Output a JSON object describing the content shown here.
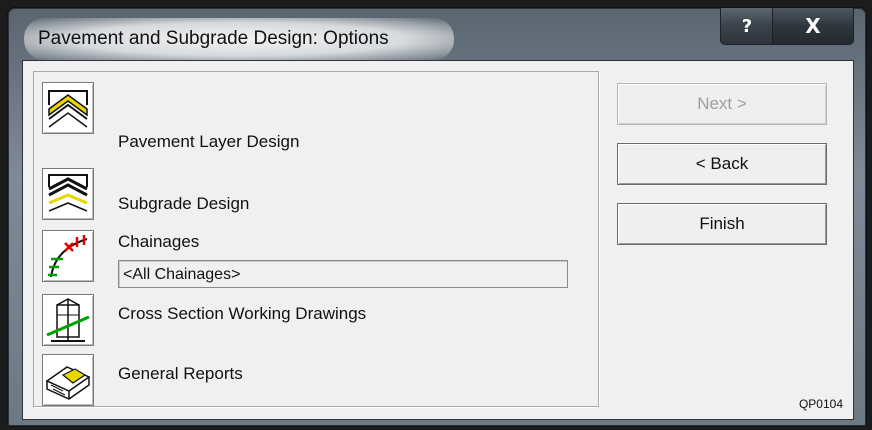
{
  "window": {
    "title": "Pavement and Subgrade Design: Options",
    "help_label": "?",
    "close_label": "X"
  },
  "options": [
    {
      "label": "Pavement Layer Design",
      "icon": "pavement-layer-icon"
    },
    {
      "label": "Subgrade Design",
      "icon": "subgrade-icon"
    },
    {
      "label": "Chainages",
      "icon": "chainages-icon"
    },
    {
      "label": "Cross Section Working Drawings",
      "icon": "cross-section-icon"
    },
    {
      "label": "General Reports",
      "icon": "general-reports-icon"
    }
  ],
  "chainages_field": {
    "value": "<All Chainages>"
  },
  "buttons": {
    "next": "Next >",
    "back": "< Back",
    "finish": "Finish"
  },
  "screen_code": "QP0104",
  "colors": {
    "accent_yellow": "#e8d800",
    "accent_green": "#00a000",
    "accent_red": "#e00000"
  }
}
